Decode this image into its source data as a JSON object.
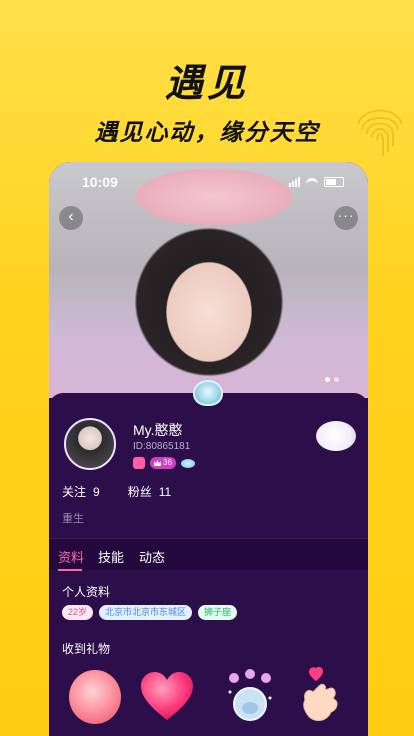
{
  "hero": {
    "title": "遇见",
    "subtitle": "遇见心动，缘分天空"
  },
  "status_bar": {
    "time": "10:09"
  },
  "profile": {
    "nickname": "My.憨憨",
    "user_id": "ID:80865181",
    "level": "36",
    "stats": {
      "follow_label": "关注",
      "follow_count": "9",
      "fans_label": "粉丝",
      "fans_count": "11"
    },
    "bio": "重生"
  },
  "tabs": [
    {
      "label": "资料",
      "active": true
    },
    {
      "label": "技能",
      "active": false
    },
    {
      "label": "动态",
      "active": false
    }
  ],
  "personal_info": {
    "title": "个人资料",
    "age": "22岁",
    "location": "北京市北京市东城区",
    "zodiac": "狮子座"
  },
  "gifts": {
    "title": "收到礼物",
    "items": [
      "rose-icon",
      "heart-icon",
      "bell-icon",
      "finger-heart-icon"
    ]
  },
  "colors": {
    "accent": "#ff6aa6",
    "panel": "#2b0e4a",
    "background": "#ffd21f"
  }
}
